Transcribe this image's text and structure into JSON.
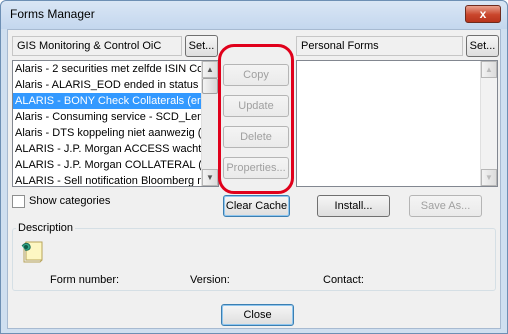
{
  "window": {
    "title": "Forms Manager",
    "close_glyph": "x"
  },
  "left_panel": {
    "location": "GIS Monitoring & Control OiC",
    "set_label": "Set...",
    "items": [
      "Alaris - 2 securities met zelfde ISIN Co",
      "Alaris - ALARIS_EOD ended in status o",
      "ALARIS - BONY Check Collaterals (err",
      "Alaris - Consuming service - SCD_Lenc",
      "Alaris - DTS koppeling niet aanwezig (I",
      "ALARIS - J.P. Morgan ACCESS wachtw",
      "ALARIS - J.P. Morgan COLLATERAL (E",
      "ALARIS - Sell notification Bloomberg n"
    ],
    "selected_index": 2
  },
  "right_panel": {
    "location": "Personal Forms",
    "set_label": "Set..."
  },
  "middle_buttons": {
    "copy": "Copy",
    "update": "Update",
    "delete": "Delete",
    "properties": "Properties..."
  },
  "bottom_row": {
    "show_categories": "Show categories",
    "clear_cache": "Clear Cache",
    "install": "Install...",
    "save_as": "Save As..."
  },
  "description": {
    "label": "Description",
    "form_number_label": "Form number:",
    "version_label": "Version:",
    "contact_label": "Contact:"
  },
  "footer": {
    "close_label": "Close"
  },
  "colors": {
    "selection": "#3399ff",
    "highlight_ring": "#e0001b"
  }
}
